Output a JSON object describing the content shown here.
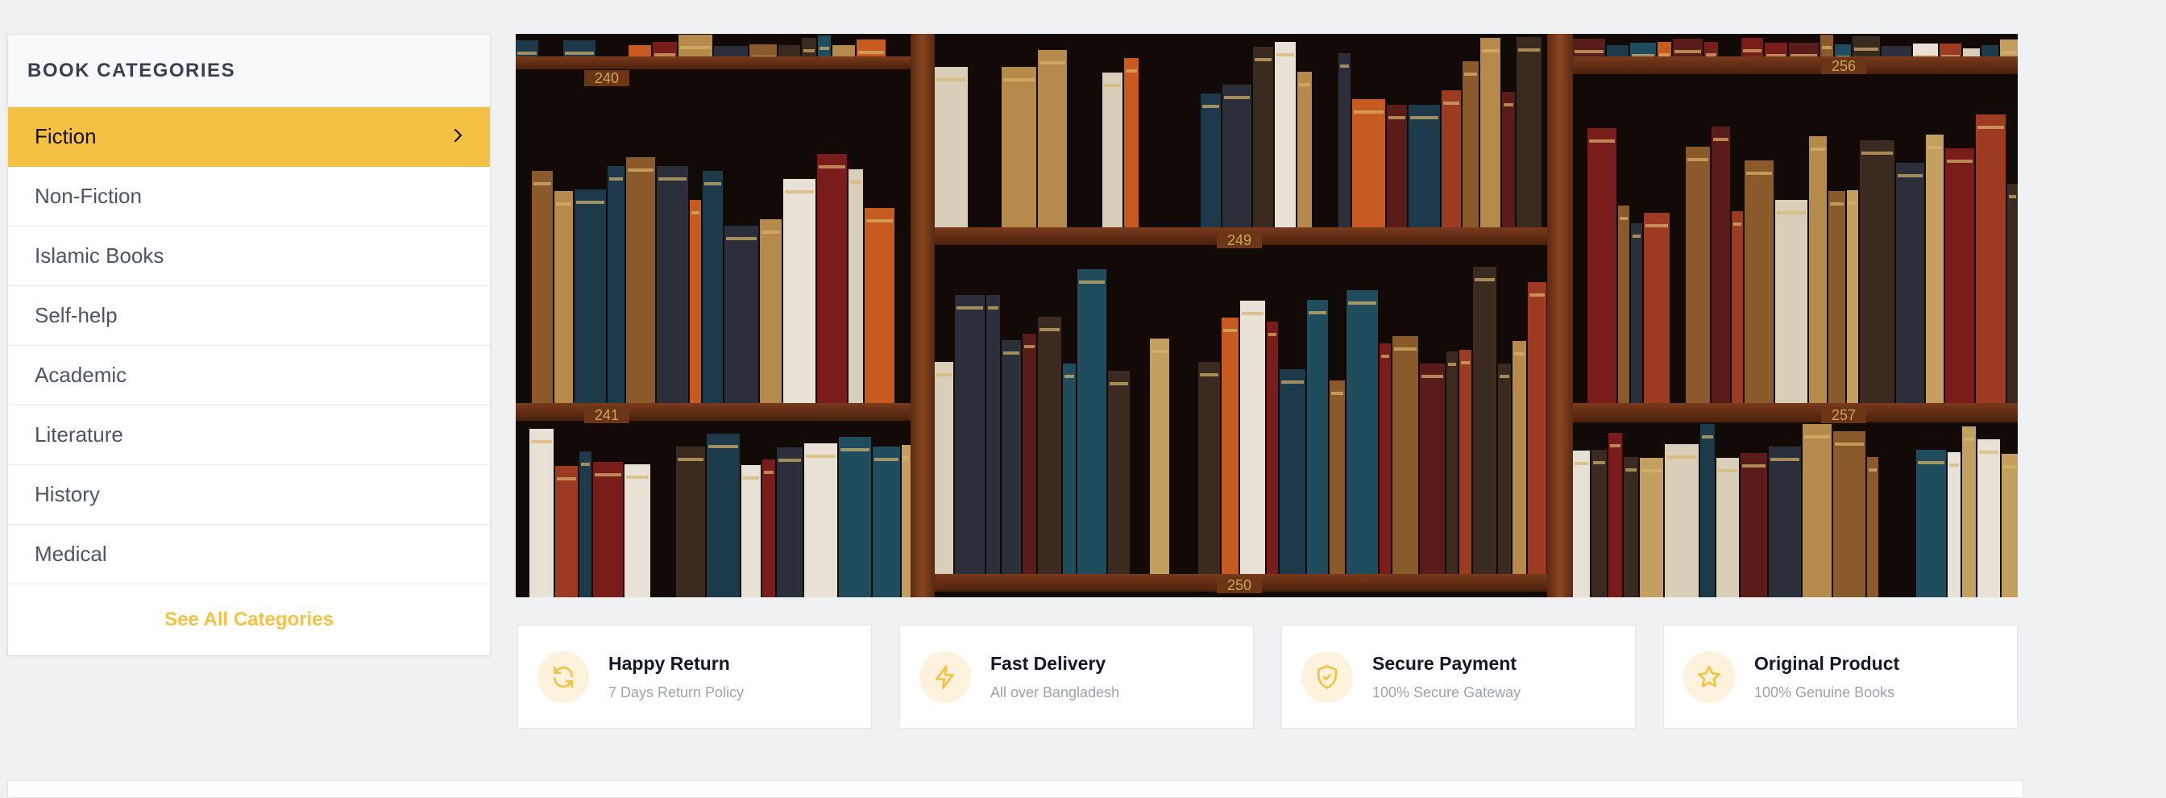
{
  "sidebar": {
    "title": "BOOK CATEGORIES",
    "items": [
      {
        "label": "Fiction"
      },
      {
        "label": "Non-Fiction"
      },
      {
        "label": "Islamic Books"
      },
      {
        "label": "Self-help"
      },
      {
        "label": "Academic"
      },
      {
        "label": "Literature"
      },
      {
        "label": "History"
      },
      {
        "label": "Medical"
      }
    ],
    "active_index": 0,
    "see_all": "See All Categories"
  },
  "banner": {
    "shelf_labels": [
      "240",
      "249",
      "256",
      "241",
      "250",
      "257"
    ]
  },
  "features": [
    {
      "title": "Happy Return",
      "subtitle": "7 Days Return Policy",
      "icon": "refresh-icon"
    },
    {
      "title": "Fast Delivery",
      "subtitle": "All over Bangladesh",
      "icon": "lightning-icon"
    },
    {
      "title": "Secure Payment",
      "subtitle": "100% Secure Gateway",
      "icon": "shield-check-icon"
    },
    {
      "title": "Original Product",
      "subtitle": "100% Genuine Books",
      "icon": "star-icon"
    }
  ],
  "colors": {
    "accent": "#f5c142",
    "page_bg": "#f0f1f3"
  }
}
